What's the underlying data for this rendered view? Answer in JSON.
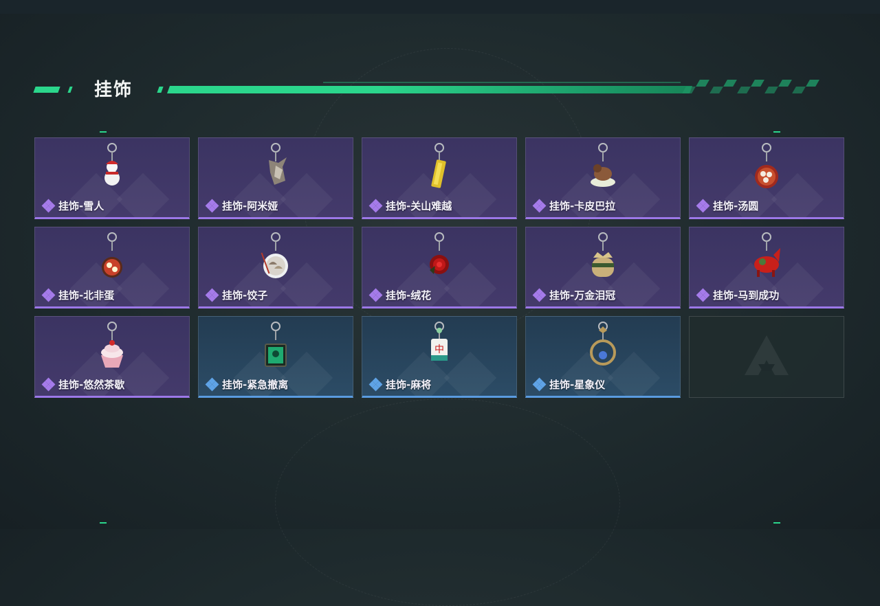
{
  "section": {
    "title": "挂饰"
  },
  "colors": {
    "accent": "#2bd68c",
    "purple_rarity": "#9c78e8",
    "blue_rarity": "#5a9be0"
  },
  "items": [
    {
      "label": "挂饰-雪人",
      "rarity": "purple",
      "icon": "snowman-charm-icon"
    },
    {
      "label": "挂饰-阿米娅",
      "rarity": "purple",
      "icon": "bunny-charm-icon"
    },
    {
      "label": "挂饰-关山难越",
      "rarity": "purple",
      "icon": "gold-bar-charm-icon"
    },
    {
      "label": "挂饰-卡皮巴拉",
      "rarity": "purple",
      "icon": "capybara-charm-icon"
    },
    {
      "label": "挂饰-汤圆",
      "rarity": "purple",
      "icon": "tangyuan-bowl-charm-icon"
    },
    {
      "label": "挂饰-北非蛋",
      "rarity": "purple",
      "icon": "shakshuka-charm-icon"
    },
    {
      "label": "挂饰-饺子",
      "rarity": "purple",
      "icon": "dumpling-plate-charm-icon"
    },
    {
      "label": "挂饰-绒花",
      "rarity": "purple",
      "icon": "velvet-flower-charm-icon"
    },
    {
      "label": "挂饰-万金泪冠",
      "rarity": "purple",
      "icon": "crown-jar-charm-icon"
    },
    {
      "label": "挂饰-马到成功",
      "rarity": "purple",
      "icon": "red-horse-charm-icon"
    },
    {
      "label": "挂饰-悠然茶歇",
      "rarity": "purple",
      "icon": "cupcake-charm-icon"
    },
    {
      "label": "挂饰-紧急撤离",
      "rarity": "blue",
      "icon": "exit-sign-charm-icon"
    },
    {
      "label": "挂饰-麻将",
      "rarity": "blue",
      "icon": "mahjong-tile-charm-icon"
    },
    {
      "label": "挂饰-星象仪",
      "rarity": "blue",
      "icon": "astrolabe-charm-icon"
    }
  ]
}
